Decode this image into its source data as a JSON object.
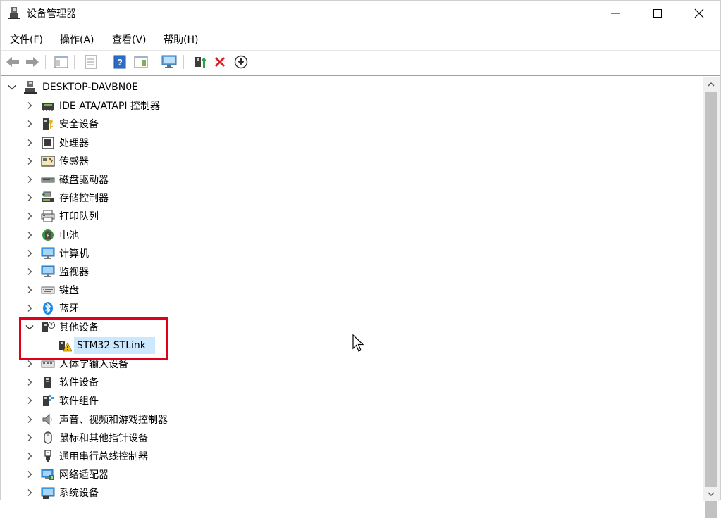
{
  "window": {
    "title": "设备管理器"
  },
  "menu": [
    {
      "label": "文件(F)"
    },
    {
      "label": "操作(A)"
    },
    {
      "label": "查看(V)"
    },
    {
      "label": "帮助(H)"
    }
  ],
  "tree": {
    "root": "DESKTOP-DAVBN0E",
    "categories": [
      {
        "label": "IDE ATA/ATAPI 控制器",
        "icon": "ide-controller-icon"
      },
      {
        "label": "安全设备",
        "icon": "security-device-icon"
      },
      {
        "label": "处理器",
        "icon": "processor-icon"
      },
      {
        "label": "传感器",
        "icon": "sensor-icon"
      },
      {
        "label": "磁盘驱动器",
        "icon": "disk-drive-icon"
      },
      {
        "label": "存储控制器",
        "icon": "storage-controller-icon"
      },
      {
        "label": "打印队列",
        "icon": "printer-icon"
      },
      {
        "label": "电池",
        "icon": "battery-icon"
      },
      {
        "label": "计算机",
        "icon": "computer-icon"
      },
      {
        "label": "监视器",
        "icon": "monitor-icon"
      },
      {
        "label": "键盘",
        "icon": "keyboard-icon"
      },
      {
        "label": "蓝牙",
        "icon": "bluetooth-icon"
      },
      {
        "label": "其他设备",
        "icon": "other-devices-icon",
        "expanded": true,
        "children": [
          {
            "label": "STM32 STLink",
            "icon": "warning-device-icon"
          }
        ]
      },
      {
        "label": "人体学输入设备",
        "icon": "hid-icon"
      },
      {
        "label": "软件设备",
        "icon": "software-device-icon"
      },
      {
        "label": "软件组件",
        "icon": "software-component-icon"
      },
      {
        "label": "声音、视频和游戏控制器",
        "icon": "sound-icon"
      },
      {
        "label": "鼠标和其他指针设备",
        "icon": "mouse-icon"
      },
      {
        "label": "通用串行总线控制器",
        "icon": "usb-icon"
      },
      {
        "label": "网络适配器",
        "icon": "network-adapter-icon"
      },
      {
        "label": "系统设备",
        "icon": "system-device-icon"
      }
    ]
  },
  "colors": {
    "highlight": "#cce8ff",
    "annotation_box": "#e0001a",
    "remove_icon": "#d91f26"
  }
}
